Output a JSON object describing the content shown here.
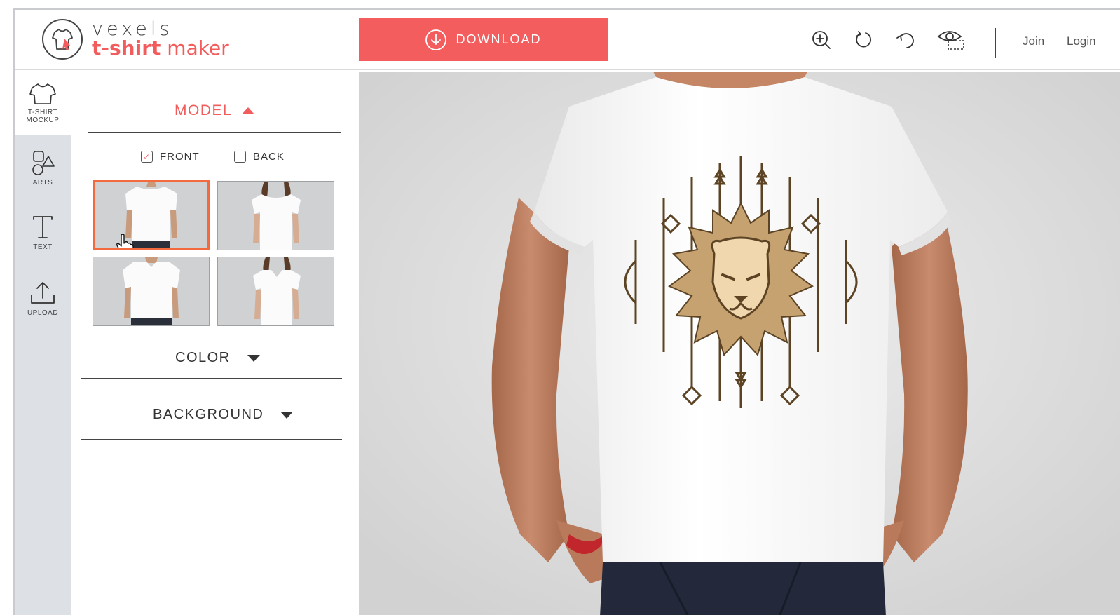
{
  "brand": {
    "line1": "vexels",
    "line2_bold": "t-shirt",
    "line2_light": " maker"
  },
  "header": {
    "download_label": "DOWNLOAD",
    "join_label": "Join",
    "login_label": "Login",
    "tools": [
      "zoom-in-icon",
      "rotate-right-icon",
      "undo-icon",
      "preview-eye-icon"
    ]
  },
  "rail": {
    "items": [
      {
        "label": "T-SHIRT MOCKUP",
        "icon": "tshirt-icon",
        "active": true
      },
      {
        "label": "ARTS",
        "icon": "shapes-icon",
        "active": false
      },
      {
        "label": "TEXT",
        "icon": "text-icon",
        "active": false
      },
      {
        "label": "UPLOAD",
        "icon": "upload-icon",
        "active": false
      }
    ]
  },
  "panel": {
    "model": {
      "title": "MODEL",
      "expanded": true
    },
    "front_label": "FRONT",
    "back_label": "BACK",
    "front_checked": true,
    "back_checked": false,
    "color": {
      "title": "COLOR",
      "expanded": false
    },
    "background": {
      "title": "BACKGROUND",
      "expanded": false
    },
    "models": [
      {
        "name": "male-round-neck",
        "selected": true
      },
      {
        "name": "female-round-neck",
        "selected": false
      },
      {
        "name": "male-v-neck",
        "selected": false
      },
      {
        "name": "female-v-neck",
        "selected": false
      }
    ]
  },
  "colors": {
    "accent": "#f35d5d",
    "rail_bg": "#dde1e6",
    "canvas_bg": "#d8d8d8",
    "selected_border": "#f26a3d"
  }
}
